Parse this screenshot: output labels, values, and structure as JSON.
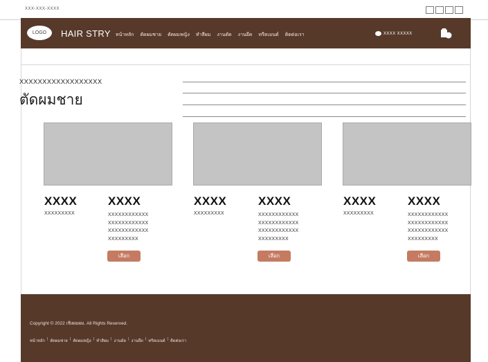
{
  "topbar": {
    "phone": "XXX-XXX-XXXX"
  },
  "header": {
    "logo": "LOGO",
    "brand": "HAIR STRY",
    "nav": [
      "หน้าหลัก",
      "ตัดผมชาย",
      "ตัดผมหญิง",
      "ทำสีผม",
      "งานดัด",
      "งานยืด",
      "ทรีตเมนต์",
      "ติดต่อเรา"
    ],
    "user_label": "XXXX XXXXX"
  },
  "main": {
    "kicker": "XXXXXXXXXXXXXXXXXX",
    "title": "ตัดผมชาย"
  },
  "cards": [
    {
      "name": "XXXX",
      "sub": "XXXXXXXXX",
      "name2": "XXXX",
      "desc": [
        "XXXXXXXXXXXX",
        "XXXXXXXXXXXX",
        "XXXXXXXXXXXX",
        "XXXXXXXXX"
      ],
      "button": "เลือก"
    },
    {
      "name": "XXXX",
      "sub": "XXXXXXXXX",
      "name2": "XXXX",
      "desc": [
        "XXXXXXXXXXXX",
        "XXXXXXXXXXXX",
        "XXXXXXXXXXXX",
        "XXXXXXXXX"
      ],
      "button": "เลือก"
    },
    {
      "name": "XXXX",
      "sub": "XXXXXXXXX",
      "name2": "XXXX",
      "desc": [
        "XXXXXXXXXXXX",
        "XXXXXXXXXXXX",
        "XXXXXXXXXXXX",
        "XXXXXXXXX"
      ],
      "button": "เลือก"
    }
  ],
  "footer": {
    "copyright": "Copyright © 2022 เชิงผมผม. All Rights Reserved.",
    "nav": [
      "หน้าหลัก",
      "ตัดผมชาย",
      "ตัดผมหญิง",
      "ทำสีผม",
      "งานดัด",
      "งานยืด",
      "ทรีตเมนต์",
      "ติดต่อเรา"
    ]
  },
  "colors": {
    "brand_brown": "#57392a",
    "accent_button": "#c47b61",
    "placeholder_gray": "#c4c4c4"
  },
  "icons": {
    "cart": "cart-icon",
    "user": "user-dot-icon",
    "social": "social-icons"
  }
}
